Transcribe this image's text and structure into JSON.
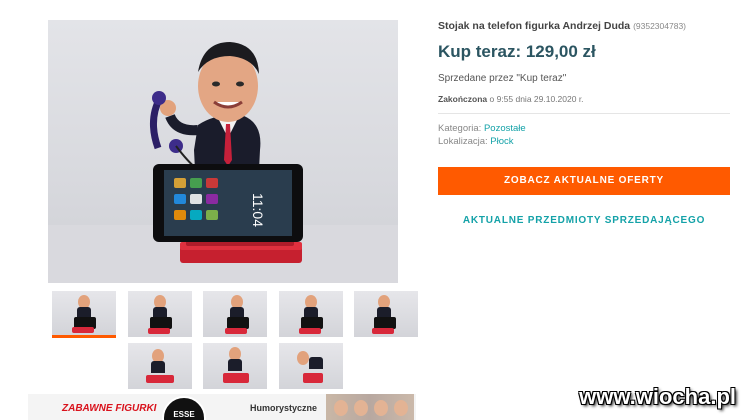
{
  "product": {
    "title": "Stojak na telefon figurka Andrzej Duda",
    "item_id": "(9352304783)",
    "price": "Kup teraz: 129,00 zł",
    "sold_by": "Sprzedane przez \"Kup teraz\"",
    "ended_label": "Zakończona",
    "ended_text": " o 9:55 dnia 29.10.2020 r.",
    "category_label": "Kategoria: ",
    "category_value": "Pozostałe",
    "location_label": "Lokalizacja: ",
    "location_value": "Płock"
  },
  "actions": {
    "primary_button": "ZOBACZ AKTUALNE OFERTY",
    "seller_link": "AKTUALNE PRZEDMIOTY SPRZEDAJĄCEGO"
  },
  "gallery": {
    "thumbnail_count": 8,
    "active_index": 0
  },
  "phone_screen_text": "11:04",
  "banner": {
    "left_text": "ZABAWNE FIGURKI",
    "logo_text": "ESSE",
    "right_text": "Humorystyczne"
  },
  "watermark": "www.wiocha.pl",
  "colors": {
    "accent_orange": "#ff5a00",
    "link_teal": "#14a2a8",
    "price_color": "#2b5561"
  }
}
